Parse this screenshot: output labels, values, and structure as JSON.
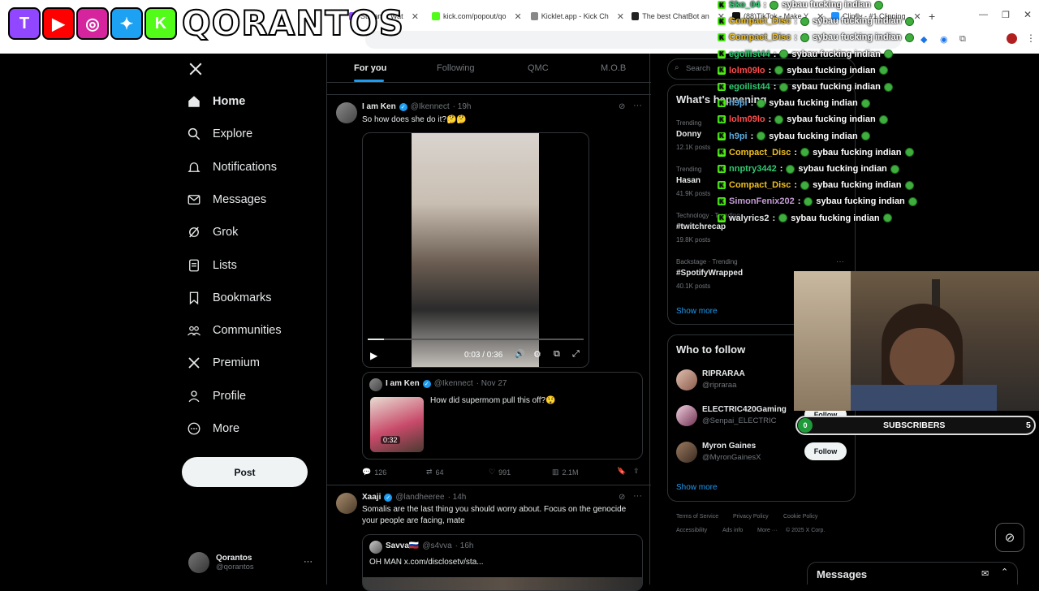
{
  "browser": {
    "tabs": [
      {
        "label": "Stream - Wat",
        "color": "#9146ff"
      },
      {
        "label": "kick.com/popout/qo",
        "color": "#53fc18"
      },
      {
        "label": "Kicklet.app - Kick Ch",
        "color": "#888888"
      },
      {
        "label": "The best ChatBot an",
        "color": "#222222"
      },
      {
        "label": "(88)TikTok - Make Y",
        "color": "#111111"
      },
      {
        "label": "Clipfly - #1 Clipping",
        "color": "#1e90ff"
      }
    ],
    "new_tab": "+"
  },
  "overlay": {
    "brand_name": "QORANTOS",
    "brand_icons": [
      {
        "name": "twitch-icon",
        "glyph": "T",
        "color": "#9146ff"
      },
      {
        "name": "youtube-icon",
        "glyph": "▶",
        "color": "#ff0000"
      },
      {
        "name": "instagram-icon",
        "glyph": "◎",
        "color": "#d6249f"
      },
      {
        "name": "twitter-bird-icon",
        "glyph": "✦",
        "color": "#1da1f2"
      },
      {
        "name": "kick-icon",
        "glyph": "K",
        "color": "#53fc18"
      }
    ]
  },
  "sidebar": {
    "items": [
      {
        "label": "Home",
        "icon": "home-icon"
      },
      {
        "label": "Explore",
        "icon": "search-icon"
      },
      {
        "label": "Notifications",
        "icon": "bell-icon"
      },
      {
        "label": "Messages",
        "icon": "envelope-icon"
      },
      {
        "label": "Grok",
        "icon": "grok-icon"
      },
      {
        "label": "Lists",
        "icon": "list-icon"
      },
      {
        "label": "Bookmarks",
        "icon": "bookmark-icon"
      },
      {
        "label": "Communities",
        "icon": "people-icon"
      },
      {
        "label": "Premium",
        "icon": "x-icon"
      },
      {
        "label": "Profile",
        "icon": "person-icon"
      },
      {
        "label": "More",
        "icon": "more-circle-icon"
      }
    ],
    "post_label": "Post",
    "profile": {
      "name": "Qorantos",
      "handle": "@qorantos",
      "more": "···"
    }
  },
  "feed": {
    "tabs": [
      "For you",
      "Following",
      "QMC",
      "M.O.B"
    ],
    "tweet1": {
      "name": "I am Ken",
      "handle": "@Ikennect",
      "time": "· 19h",
      "text": "So how does she do it?🤔🤔",
      "video_time": "0:03 / 0:36",
      "quote": {
        "name": "I am Ken",
        "handle": "@Ikennect",
        "time": "· Nov 27",
        "text": "How did supermom pull this off?😲",
        "duration": "0:32"
      },
      "replies": "126",
      "reposts": "64",
      "likes": "991",
      "views": "2.1M"
    },
    "tweet2": {
      "name": "Xaaji",
      "handle": "@landheeree",
      "time": "· 14h",
      "text": "Somalis are the last thing you should worry about. Focus on the genocide your people are facing, mate",
      "quote": {
        "name": "Savva🇷🇺",
        "handle": "@s4vva",
        "time": "· 16h",
        "text": "OH MAN x.com/disclosetv/sta..."
      }
    }
  },
  "right": {
    "search_placeholder": "Search",
    "happening_title": "What's happening",
    "trends": [
      {
        "meta": "Trending",
        "name": "Donny",
        "posts": "12.1K posts"
      },
      {
        "meta": "Trending",
        "name": "Hasan",
        "posts": "41.9K posts"
      },
      {
        "meta": "Technology · Trending",
        "name": "#twitchrecap",
        "posts": "19.8K posts"
      },
      {
        "meta": "Backstage · Trending",
        "name": "#SpotifyWrapped",
        "posts": "40.1K posts"
      }
    ],
    "show_more": "Show more",
    "who_title": "Who to follow",
    "follow": [
      {
        "name": "RIPRARAA",
        "handle": "@ripraraa",
        "button": ""
      },
      {
        "name": "ELECTRIC420Gaming",
        "handle": "@Senpai_ELECTRIC",
        "button": "Follow"
      },
      {
        "name": "Myron Gaines",
        "handle": "@MyronGainesX",
        "button": "Follow"
      }
    ],
    "footer": [
      "Terms of Service",
      "Privacy Policy",
      "Cookie Policy",
      "Accessibility",
      "Ads info",
      "More ···",
      "© 2025 X Corp."
    ],
    "messages_dock": "Messages"
  },
  "chat": [
    {
      "user": "Sko_04",
      "color": "#2ecc71",
      "msg": "sybau fucking indian"
    },
    {
      "user": "Compact_Disc",
      "color": "#f0c020",
      "msg": "sybau fucking indian"
    },
    {
      "user": "Compact_Disc",
      "color": "#f0c020",
      "msg": "sybau fucking indian"
    },
    {
      "user": "egoilist44",
      "color": "#2ecc71",
      "msg": "sybau fucking indian"
    },
    {
      "user": "lolm09lo",
      "color": "#ff4d4d",
      "msg": "sybau fucking indian"
    },
    {
      "user": "egoilist44",
      "color": "#2ecc71",
      "msg": "sybau fucking indian"
    },
    {
      "user": "h9pi",
      "color": "#5dade2",
      "msg": "sybau fucking indian"
    },
    {
      "user": "lolm09lo",
      "color": "#ff4d4d",
      "msg": "sybau fucking indian"
    },
    {
      "user": "h9pi",
      "color": "#5dade2",
      "msg": "sybau fucking indian"
    },
    {
      "user": "Compact_Disc",
      "color": "#f0c020",
      "msg": "sybau fucking indian"
    },
    {
      "user": "nnptry3442",
      "color": "#2ecc71",
      "msg": "sybau fucking indian"
    },
    {
      "user": "Compact_Disc",
      "color": "#f0c020",
      "msg": "sybau fucking indian"
    },
    {
      "user": "SimonFenix202",
      "color": "#c39bd3",
      "msg": "sybau fucking indian"
    },
    {
      "user": "walyrics2",
      "color": "#e7e9ea",
      "msg": "sybau fucking indian"
    }
  ],
  "subscribers": {
    "label": "SUBSCRIBERS",
    "current": "0",
    "goal": "5"
  }
}
